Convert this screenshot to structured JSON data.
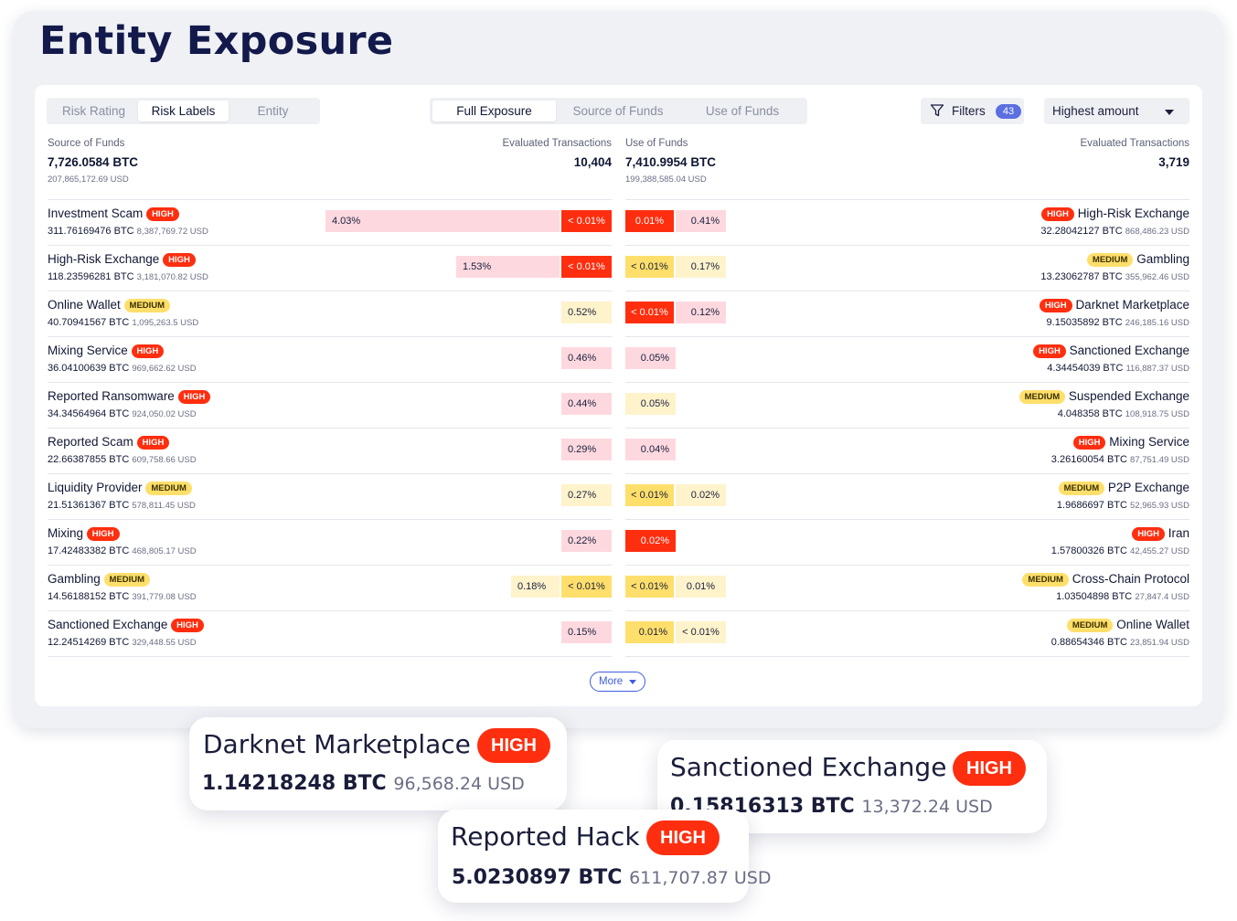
{
  "title": "Entity Exposure",
  "tabs_view": [
    "Risk Rating",
    "Risk Labels",
    "Entity"
  ],
  "tabs_view_active": 1,
  "tabs_flow": [
    "Full Exposure",
    "Source of Funds",
    "Use of Funds"
  ],
  "tabs_flow_active": 0,
  "filters": {
    "label": "Filters",
    "count": "43"
  },
  "sort": {
    "selected": "Highest amount"
  },
  "source": {
    "label": "Source of Funds",
    "amount": "7,726.0584 BTC",
    "usd": "207,865,172.69 USD",
    "tx_label": "Evaluated Transactions",
    "tx_count": "10,404"
  },
  "use": {
    "label": "Use of Funds",
    "amount": "7,410.9954 BTC",
    "usd": "199,388,585.04 USD",
    "tx_label": "Evaluated Transactions",
    "tx_count": "3,719"
  },
  "left_rows": [
    {
      "name": "Investment Scam",
      "risk": "HIGH",
      "btc": "311.76169476 BTC",
      "usd": "8,387,769.72 USD",
      "bars": [
        {
          "text": "4.03%",
          "color": "pink",
          "pct": 4.03,
          "align": "tl"
        },
        {
          "text": "< 0.01%",
          "color": "red",
          "pct": 0.01,
          "align": "tc"
        }
      ]
    },
    {
      "name": "High-Risk Exchange",
      "risk": "HIGH",
      "btc": "118.23596281 BTC",
      "usd": "3,181,070.82 USD",
      "bars": [
        {
          "text": "1.53%",
          "color": "pink",
          "pct": 1.53,
          "align": "tl"
        },
        {
          "text": "< 0.01%",
          "color": "red",
          "pct": 0.01,
          "align": "tc"
        }
      ]
    },
    {
      "name": "Online Wallet",
      "risk": "MEDIUM",
      "btc": "40.70941567 BTC",
      "usd": "1,095,263.5 USD",
      "bars": [
        {
          "text": "0.52%",
          "color": "lyellow",
          "pct": 0.52,
          "align": "tl"
        }
      ]
    },
    {
      "name": "Mixing Service",
      "risk": "HIGH",
      "btc": "36.04100639 BTC",
      "usd": "969,662.62 USD",
      "bars": [
        {
          "text": "0.46%",
          "color": "pink",
          "pct": 0.46,
          "align": "tl"
        }
      ]
    },
    {
      "name": "Reported Ransomware",
      "risk": "HIGH",
      "btc": "34.34564964 BTC",
      "usd": "924,050.02 USD",
      "bars": [
        {
          "text": "0.44%",
          "color": "pink",
          "pct": 0.44,
          "align": "tl"
        }
      ]
    },
    {
      "name": "Reported Scam",
      "risk": "HIGH",
      "btc": "22.66387855 BTC",
      "usd": "609,758.66 USD",
      "bars": [
        {
          "text": "0.29%",
          "color": "pink",
          "pct": 0.29,
          "align": "tl"
        }
      ]
    },
    {
      "name": "Liquidity Provider",
      "risk": "MEDIUM",
      "btc": "21.51361367 BTC",
      "usd": "578,811.45 USD",
      "bars": [
        {
          "text": "0.27%",
          "color": "lyellow",
          "pct": 0.27,
          "align": "tl"
        }
      ]
    },
    {
      "name": "Mixing",
      "risk": "HIGH",
      "btc": "17.42483382 BTC",
      "usd": "468,805.17 USD",
      "bars": [
        {
          "text": "0.22%",
          "color": "pink",
          "pct": 0.22,
          "align": "tl"
        }
      ]
    },
    {
      "name": "Gambling",
      "risk": "MEDIUM",
      "btc": "14.56188152 BTC",
      "usd": "391,779.08 USD",
      "bars": [
        {
          "text": "0.18%",
          "color": "lyellow",
          "pct": 0.18,
          "align": "tl"
        },
        {
          "text": "< 0.01%",
          "color": "yellow",
          "pct": 0.01,
          "align": "tc"
        }
      ]
    },
    {
      "name": "Sanctioned Exchange",
      "risk": "HIGH",
      "btc": "12.24514269 BTC",
      "usd": "329,448.55 USD",
      "bars": [
        {
          "text": "0.15%",
          "color": "pink",
          "pct": 0.15,
          "align": "tl"
        }
      ]
    }
  ],
  "right_rows": [
    {
      "name": "High-Risk Exchange",
      "risk": "HIGH",
      "btc": "32.28042127 BTC",
      "usd": "868,486.23 USD",
      "bars": [
        {
          "text": "0.01%",
          "color": "red",
          "pct": 0.01,
          "align": "tc"
        },
        {
          "text": "0.41%",
          "color": "pink",
          "pct": 0.41,
          "align": "tr"
        }
      ]
    },
    {
      "name": "Gambling",
      "risk": "MEDIUM",
      "btc": "13.23062787 BTC",
      "usd": "355,962.46 USD",
      "bars": [
        {
          "text": "< 0.01%",
          "color": "yellow",
          "pct": 0.01,
          "align": "tc"
        },
        {
          "text": "0.17%",
          "color": "lyellow",
          "pct": 0.17,
          "align": "tr"
        }
      ]
    },
    {
      "name": "Darknet Marketplace",
      "risk": "HIGH",
      "btc": "9.15035892 BTC",
      "usd": "246,185.16 USD",
      "bars": [
        {
          "text": "< 0.01%",
          "color": "red",
          "pct": 0.01,
          "align": "tc"
        },
        {
          "text": "0.12%",
          "color": "pink",
          "pct": 0.12,
          "align": "tr"
        }
      ]
    },
    {
      "name": "Sanctioned Exchange",
      "risk": "HIGH",
      "btc": "4.34454039 BTC",
      "usd": "116,887.37 USD",
      "bars": [
        {
          "text": "0.05%",
          "color": "pink",
          "pct": 0.05,
          "align": "tr"
        }
      ]
    },
    {
      "name": "Suspended Exchange",
      "risk": "MEDIUM",
      "btc": "4.048358 BTC",
      "usd": "108,918.75 USD",
      "bars": [
        {
          "text": "0.05%",
          "color": "lyellow",
          "pct": 0.05,
          "align": "tr"
        }
      ]
    },
    {
      "name": "Mixing Service",
      "risk": "HIGH",
      "btc": "3.26160054 BTC",
      "usd": "87,751.49 USD",
      "bars": [
        {
          "text": "0.04%",
          "color": "pink",
          "pct": 0.04,
          "align": "tr"
        }
      ]
    },
    {
      "name": "P2P Exchange",
      "risk": "MEDIUM",
      "btc": "1.9686697 BTC",
      "usd": "52,965.93 USD",
      "bars": [
        {
          "text": "< 0.01%",
          "color": "yellow",
          "pct": 0.01,
          "align": "tc"
        },
        {
          "text": "0.02%",
          "color": "lyellow",
          "pct": 0.02,
          "align": "tr"
        }
      ]
    },
    {
      "name": "Iran",
      "risk": "HIGH",
      "btc": "1.57800326 BTC",
      "usd": "42,455.27 USD",
      "bars": [
        {
          "text": "0.02%",
          "color": "red",
          "pct": 0.02,
          "align": "tr"
        }
      ]
    },
    {
      "name": "Cross-Chain Protocol",
      "risk": "MEDIUM",
      "btc": "1.03504898 BTC",
      "usd": "27,847.4 USD",
      "bars": [
        {
          "text": "< 0.01%",
          "color": "yellow",
          "pct": 0.01,
          "align": "tc"
        },
        {
          "text": "0.01%",
          "color": "lyellow",
          "pct": 0.01,
          "align": "tc"
        }
      ]
    },
    {
      "name": "Online Wallet",
      "risk": "MEDIUM",
      "btc": "0.88654346 BTC",
      "usd": "23,851.94 USD",
      "bars": [
        {
          "text": "0.01%",
          "color": "yellow",
          "pct": 0.01,
          "align": "tr"
        },
        {
          "text": "< 0.01%",
          "color": "lyellow",
          "pct": 0.01,
          "align": "tc"
        }
      ]
    }
  ],
  "more_label": "More",
  "cards": [
    {
      "title": "Darknet Marketplace",
      "risk": "HIGH",
      "btc": "1.14218248 BTC",
      "usd": "96,568.24 USD"
    },
    {
      "title": "Sanctioned Exchange",
      "risk": "HIGH",
      "btc": "0.15816313 BTC",
      "usd": "13,372.24 USD"
    },
    {
      "title": "Reported Hack",
      "risk": "HIGH",
      "btc": "5.0230897 BTC",
      "usd": "611,707.87 USD"
    }
  ],
  "colors": {
    "high": "#ff2e0f",
    "medium": "#ffdf6b",
    "pink": "#fdd9df",
    "light_yellow": "#fff3cc",
    "accent": "#3d5de0",
    "filter_badge": "#5b6fe0"
  }
}
